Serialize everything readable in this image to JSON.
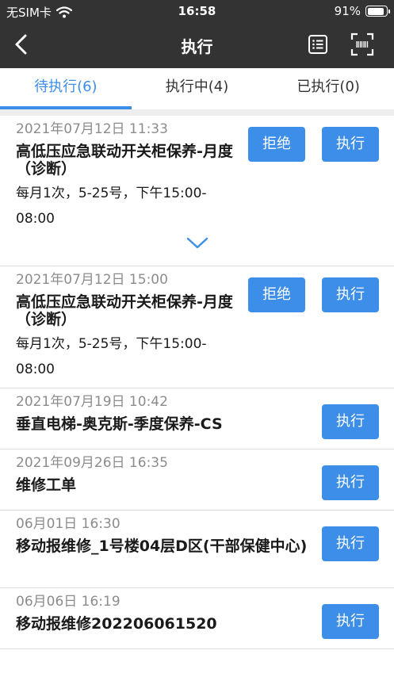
{
  "status": {
    "carrier": "无SIM卡",
    "time": "16:58",
    "battery": "91%",
    "battery_level": 0.91
  },
  "nav": {
    "title": "执行"
  },
  "tabs": [
    {
      "label": "待执行(6)",
      "active": true
    },
    {
      "label": "执行中(4)",
      "active": false
    },
    {
      "label": "已执行(0)",
      "active": false
    }
  ],
  "buttons": {
    "reject": "拒绝",
    "execute": "执行"
  },
  "tasks": [
    {
      "time": "2021年07月12日 11:33",
      "title": "高低压应急联动开关柜保养-月度（诊断）",
      "subtitle": "每月1次，5-25号，下午15:00-08:00"
    },
    {
      "time": "2021年07月12日 15:00",
      "title": "高低压应急联动开关柜保养-月度（诊断）",
      "subtitle": "每月1次，5-25号，下午15:00-08:00"
    },
    {
      "time": "2021年07月19日 10:42",
      "title": "垂直电梯-奥克斯-季度保养-CS"
    },
    {
      "time": "2021年09月26日 16:35",
      "title": "维修工单"
    },
    {
      "time": "06月01日 16:30",
      "title": "移动报维修_1号楼04层D区(干部保健中心)"
    },
    {
      "time": "06月06日 16:19",
      "title": "移动报维修202206061520"
    }
  ]
}
